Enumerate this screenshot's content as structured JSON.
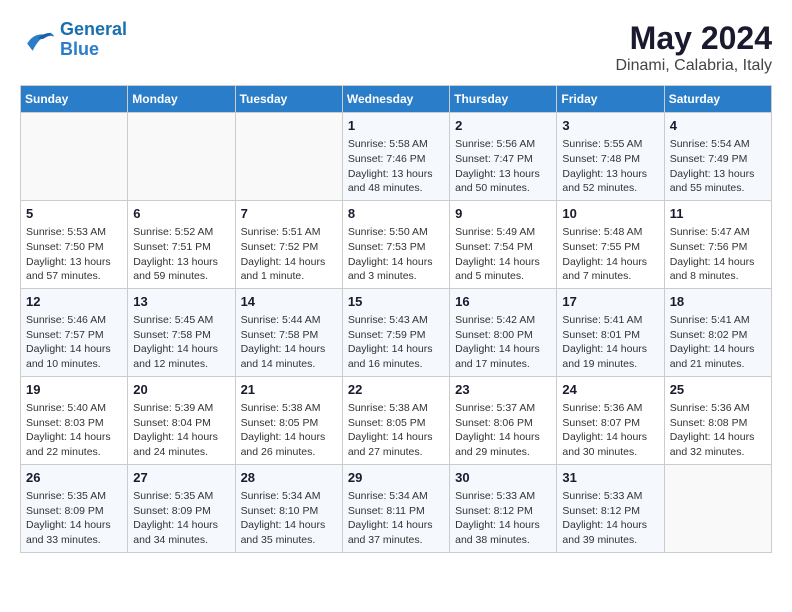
{
  "header": {
    "logo_line1": "General",
    "logo_line2": "Blue",
    "title": "May 2024",
    "location": "Dinami, Calabria, Italy"
  },
  "weekdays": [
    "Sunday",
    "Monday",
    "Tuesday",
    "Wednesday",
    "Thursday",
    "Friday",
    "Saturday"
  ],
  "weeks": [
    [
      {
        "day": "",
        "info": ""
      },
      {
        "day": "",
        "info": ""
      },
      {
        "day": "",
        "info": ""
      },
      {
        "day": "1",
        "info": "Sunrise: 5:58 AM\nSunset: 7:46 PM\nDaylight: 13 hours\nand 48 minutes."
      },
      {
        "day": "2",
        "info": "Sunrise: 5:56 AM\nSunset: 7:47 PM\nDaylight: 13 hours\nand 50 minutes."
      },
      {
        "day": "3",
        "info": "Sunrise: 5:55 AM\nSunset: 7:48 PM\nDaylight: 13 hours\nand 52 minutes."
      },
      {
        "day": "4",
        "info": "Sunrise: 5:54 AM\nSunset: 7:49 PM\nDaylight: 13 hours\nand 55 minutes."
      }
    ],
    [
      {
        "day": "5",
        "info": "Sunrise: 5:53 AM\nSunset: 7:50 PM\nDaylight: 13 hours\nand 57 minutes."
      },
      {
        "day": "6",
        "info": "Sunrise: 5:52 AM\nSunset: 7:51 PM\nDaylight: 13 hours\nand 59 minutes."
      },
      {
        "day": "7",
        "info": "Sunrise: 5:51 AM\nSunset: 7:52 PM\nDaylight: 14 hours\nand 1 minute."
      },
      {
        "day": "8",
        "info": "Sunrise: 5:50 AM\nSunset: 7:53 PM\nDaylight: 14 hours\nand 3 minutes."
      },
      {
        "day": "9",
        "info": "Sunrise: 5:49 AM\nSunset: 7:54 PM\nDaylight: 14 hours\nand 5 minutes."
      },
      {
        "day": "10",
        "info": "Sunrise: 5:48 AM\nSunset: 7:55 PM\nDaylight: 14 hours\nand 7 minutes."
      },
      {
        "day": "11",
        "info": "Sunrise: 5:47 AM\nSunset: 7:56 PM\nDaylight: 14 hours\nand 8 minutes."
      }
    ],
    [
      {
        "day": "12",
        "info": "Sunrise: 5:46 AM\nSunset: 7:57 PM\nDaylight: 14 hours\nand 10 minutes."
      },
      {
        "day": "13",
        "info": "Sunrise: 5:45 AM\nSunset: 7:58 PM\nDaylight: 14 hours\nand 12 minutes."
      },
      {
        "day": "14",
        "info": "Sunrise: 5:44 AM\nSunset: 7:58 PM\nDaylight: 14 hours\nand 14 minutes."
      },
      {
        "day": "15",
        "info": "Sunrise: 5:43 AM\nSunset: 7:59 PM\nDaylight: 14 hours\nand 16 minutes."
      },
      {
        "day": "16",
        "info": "Sunrise: 5:42 AM\nSunset: 8:00 PM\nDaylight: 14 hours\nand 17 minutes."
      },
      {
        "day": "17",
        "info": "Sunrise: 5:41 AM\nSunset: 8:01 PM\nDaylight: 14 hours\nand 19 minutes."
      },
      {
        "day": "18",
        "info": "Sunrise: 5:41 AM\nSunset: 8:02 PM\nDaylight: 14 hours\nand 21 minutes."
      }
    ],
    [
      {
        "day": "19",
        "info": "Sunrise: 5:40 AM\nSunset: 8:03 PM\nDaylight: 14 hours\nand 22 minutes."
      },
      {
        "day": "20",
        "info": "Sunrise: 5:39 AM\nSunset: 8:04 PM\nDaylight: 14 hours\nand 24 minutes."
      },
      {
        "day": "21",
        "info": "Sunrise: 5:38 AM\nSunset: 8:05 PM\nDaylight: 14 hours\nand 26 minutes."
      },
      {
        "day": "22",
        "info": "Sunrise: 5:38 AM\nSunset: 8:05 PM\nDaylight: 14 hours\nand 27 minutes."
      },
      {
        "day": "23",
        "info": "Sunrise: 5:37 AM\nSunset: 8:06 PM\nDaylight: 14 hours\nand 29 minutes."
      },
      {
        "day": "24",
        "info": "Sunrise: 5:36 AM\nSunset: 8:07 PM\nDaylight: 14 hours\nand 30 minutes."
      },
      {
        "day": "25",
        "info": "Sunrise: 5:36 AM\nSunset: 8:08 PM\nDaylight: 14 hours\nand 32 minutes."
      }
    ],
    [
      {
        "day": "26",
        "info": "Sunrise: 5:35 AM\nSunset: 8:09 PM\nDaylight: 14 hours\nand 33 minutes."
      },
      {
        "day": "27",
        "info": "Sunrise: 5:35 AM\nSunset: 8:09 PM\nDaylight: 14 hours\nand 34 minutes."
      },
      {
        "day": "28",
        "info": "Sunrise: 5:34 AM\nSunset: 8:10 PM\nDaylight: 14 hours\nand 35 minutes."
      },
      {
        "day": "29",
        "info": "Sunrise: 5:34 AM\nSunset: 8:11 PM\nDaylight: 14 hours\nand 37 minutes."
      },
      {
        "day": "30",
        "info": "Sunrise: 5:33 AM\nSunset: 8:12 PM\nDaylight: 14 hours\nand 38 minutes."
      },
      {
        "day": "31",
        "info": "Sunrise: 5:33 AM\nSunset: 8:12 PM\nDaylight: 14 hours\nand 39 minutes."
      },
      {
        "day": "",
        "info": ""
      }
    ]
  ]
}
